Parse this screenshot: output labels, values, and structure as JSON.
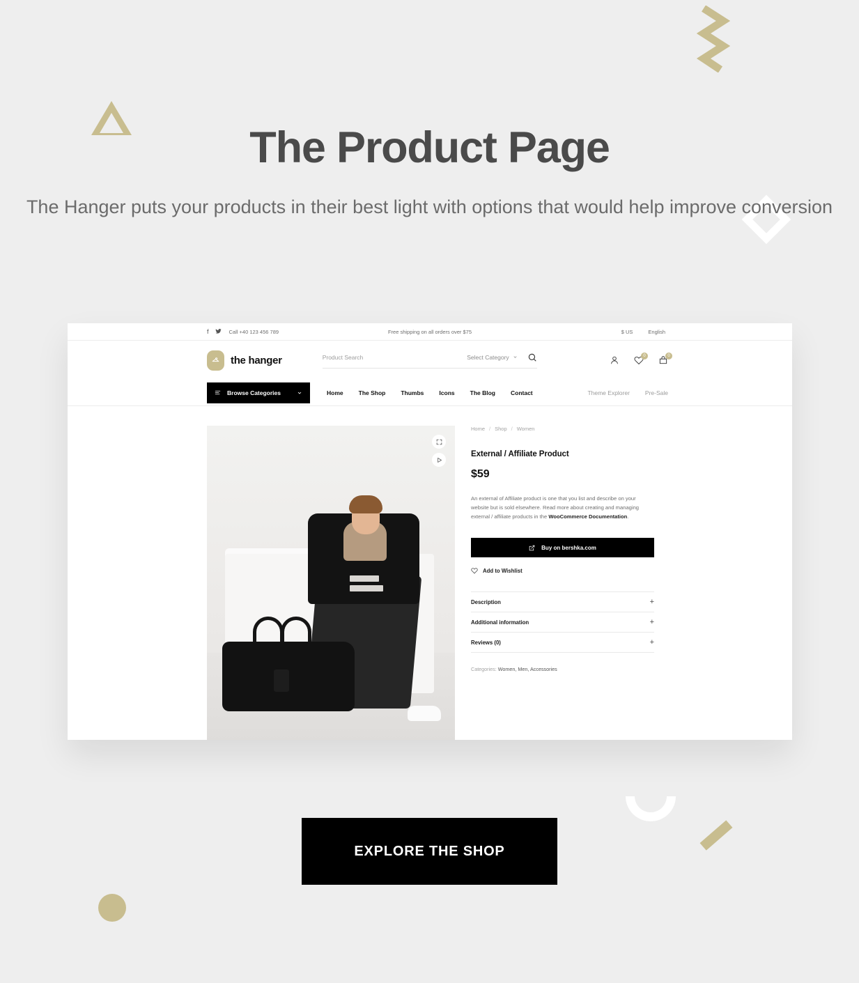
{
  "hero": {
    "title": "The Product Page",
    "subtitle": "The Hanger puts your products in their best light with options that would help improve conversion"
  },
  "cta": {
    "label": "EXPLORE THE SHOP"
  },
  "colors": {
    "gold": "#c8bd8f",
    "background": "#eeeeee",
    "accent_black": "#000000",
    "text_dark": "#4a4a4a"
  },
  "site": {
    "topbar": {
      "phone": "Call +40 123 456 789",
      "shipping": "Free shipping on all orders over $75",
      "currency": "$ US",
      "language": "English",
      "social": [
        "facebook-icon",
        "twitter-icon"
      ]
    },
    "header": {
      "brand_name": "the hanger",
      "brand_icon": "hanger-icon",
      "search_placeholder": "Product Search",
      "search_value": "",
      "category_select": "Select Category",
      "search_icon": "search-icon",
      "actions": [
        {
          "name": "account-icon",
          "badge": null
        },
        {
          "name": "wishlist-icon",
          "badge": "0"
        },
        {
          "name": "cart-icon",
          "badge": "0"
        }
      ]
    },
    "nav": {
      "browse_label": "Browse Categories",
      "menu": [
        "Home",
        "The Shop",
        "Thumbs",
        "Icons",
        "The Blog",
        "Contact"
      ],
      "right": [
        "Theme Explorer",
        "Pre-Sale"
      ]
    },
    "product": {
      "breadcrumb": [
        "Home",
        "Shop",
        "Women"
      ],
      "title": "External / Affiliate Product",
      "price": "$59",
      "description_part1": "An external of Affiliate product is one that you list and describe on your website but is sold elsewhere. Read more about creating and managing external / affiliate products in the ",
      "description_link": "WooCommerce Documentation",
      "description_part2": ".",
      "buy_label": "Buy on bershka.com",
      "buy_icon": "external-link-icon",
      "wishlist_label": "Add to Wishlist",
      "wishlist_icon": "heart-icon",
      "accordions": [
        {
          "label": "Description",
          "toggle": "+"
        },
        {
          "label": "Additional information",
          "toggle": "+"
        },
        {
          "label": "Reviews (0)",
          "toggle": "+"
        }
      ],
      "categories_label": "Categories:",
      "categories_value": "Women, Men, Accessories",
      "gallery_zoom_icon": "expand-icon",
      "gallery_video_icon": "play-icon"
    }
  }
}
